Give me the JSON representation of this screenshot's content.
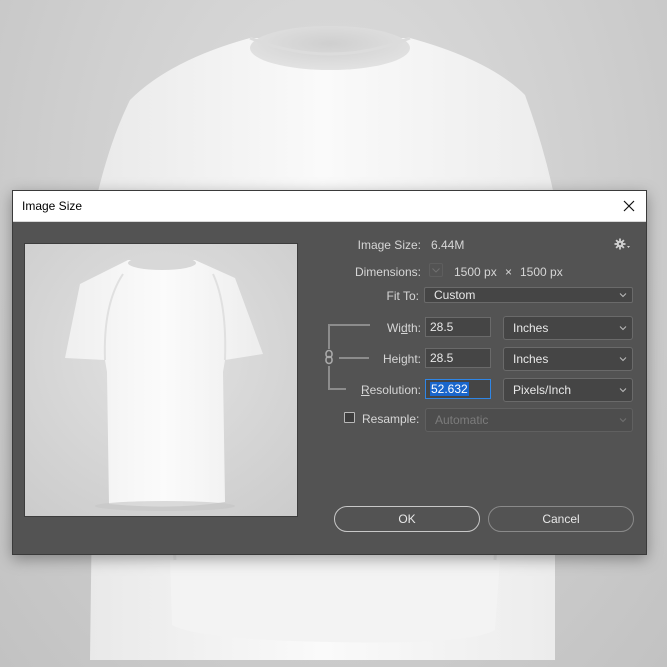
{
  "dialog": {
    "title": "Image Size",
    "close_label": "close",
    "image_size_label": "Image Size:",
    "image_size_value": "6.44M",
    "dimensions_label": "Dimensions:",
    "dimensions_width": "1500 px",
    "dimensions_times": "×",
    "dimensions_height": "1500 px",
    "fit_to_label": "Fit To:",
    "fit_to_value": "Custom",
    "width_label_pre": "Wi",
    "width_label_u": "d",
    "width_label_post": "th:",
    "width_value": "28.5",
    "width_unit": "Inches",
    "height_label_pre": "Hei",
    "height_label_u": "g",
    "height_label_post": "ht:",
    "height_value": "28.5",
    "height_unit": "Inches",
    "resolution_label_u": "R",
    "resolution_label_post": "esolution:",
    "resolution_value": "52.632",
    "resolution_unit": "Pixels/Inch",
    "resample_label": "Resample:",
    "resample_checked": false,
    "resample_value": "Automatic",
    "ok_label": "OK",
    "cancel_label": "Cancel"
  },
  "icons": {
    "settings": "gear-icon",
    "link": "chain-link-icon",
    "close": "close-icon",
    "dimensions_dropdown": "chevron-down-icon"
  },
  "colors": {
    "dialog_bg": "#535353",
    "selection": "#1a66cc",
    "focus_border": "#2f86e6"
  }
}
